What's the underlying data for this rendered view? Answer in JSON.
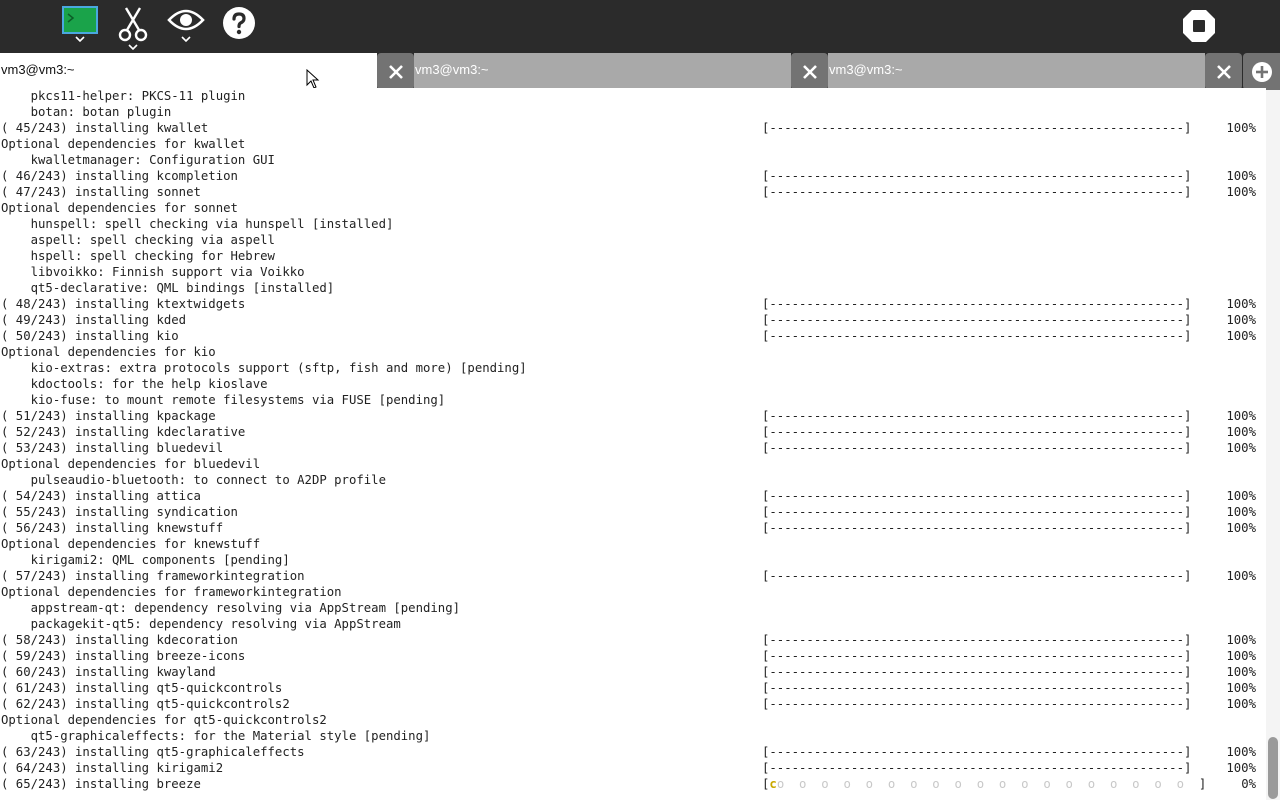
{
  "toolbar": {
    "icons": [
      "terminal-icon",
      "scissors-icon",
      "eye-icon",
      "help-icon",
      "stop-icon"
    ]
  },
  "tabs": [
    {
      "label": "vm3@vm3:~",
      "active": true
    },
    {
      "label": "vm3@vm3:~",
      "active": false
    },
    {
      "label": "vm3@vm3:~",
      "active": false
    }
  ],
  "terminal": {
    "lines": [
      {
        "text": "    pkcs11-helper: PKCS-11 plugin"
      },
      {
        "text": "    botan: botan plugin"
      },
      {
        "text": "( 45/243) installing kwallet",
        "bar": "[--------------------------------------------------------]",
        "pct": "100%"
      },
      {
        "text": "Optional dependencies for kwallet"
      },
      {
        "text": "    kwalletmanager: Configuration GUI"
      },
      {
        "text": "( 46/243) installing kcompletion",
        "bar": "[--------------------------------------------------------]",
        "pct": "100%"
      },
      {
        "text": "( 47/243) installing sonnet",
        "bar": "[--------------------------------------------------------]",
        "pct": "100%"
      },
      {
        "text": "Optional dependencies for sonnet"
      },
      {
        "text": "    hunspell: spell checking via hunspell [installed]"
      },
      {
        "text": "    aspell: spell checking via aspell"
      },
      {
        "text": "    hspell: spell checking for Hebrew"
      },
      {
        "text": "    libvoikko: Finnish support via Voikko"
      },
      {
        "text": "    qt5-declarative: QML bindings [installed]"
      },
      {
        "text": "( 48/243) installing ktextwidgets",
        "bar": "[--------------------------------------------------------]",
        "pct": "100%"
      },
      {
        "text": "( 49/243) installing kded",
        "bar": "[--------------------------------------------------------]",
        "pct": "100%"
      },
      {
        "text": "( 50/243) installing kio",
        "bar": "[--------------------------------------------------------]",
        "pct": "100%"
      },
      {
        "text": "Optional dependencies for kio"
      },
      {
        "text": "    kio-extras: extra protocols support (sftp, fish and more) [pending]"
      },
      {
        "text": "    kdoctools: for the help kioslave"
      },
      {
        "text": "    kio-fuse: to mount remote filesystems via FUSE [pending]"
      },
      {
        "text": "( 51/243) installing kpackage",
        "bar": "[--------------------------------------------------------]",
        "pct": "100%"
      },
      {
        "text": "( 52/243) installing kdeclarative",
        "bar": "[--------------------------------------------------------]",
        "pct": "100%"
      },
      {
        "text": "( 53/243) installing bluedevil",
        "bar": "[--------------------------------------------------------]",
        "pct": "100%"
      },
      {
        "text": "Optional dependencies for bluedevil"
      },
      {
        "text": "    pulseaudio-bluetooth: to connect to A2DP profile"
      },
      {
        "text": "( 54/243) installing attica",
        "bar": "[--------------------------------------------------------]",
        "pct": "100%"
      },
      {
        "text": "( 55/243) installing syndication",
        "bar": "[--------------------------------------------------------]",
        "pct": "100%"
      },
      {
        "text": "( 56/243) installing knewstuff",
        "bar": "[--------------------------------------------------------]",
        "pct": "100%"
      },
      {
        "text": "Optional dependencies for knewstuff"
      },
      {
        "text": "    kirigami2: QML components [pending]"
      },
      {
        "text": "( 57/243) installing frameworkintegration",
        "bar": "[--------------------------------------------------------]",
        "pct": "100%"
      },
      {
        "text": "Optional dependencies for frameworkintegration"
      },
      {
        "text": "    appstream-qt: dependency resolving via AppStream [pending]"
      },
      {
        "text": "    packagekit-qt5: dependency resolving via AppStream"
      },
      {
        "text": "( 58/243) installing kdecoration",
        "bar": "[--------------------------------------------------------]",
        "pct": "100%"
      },
      {
        "text": "( 59/243) installing breeze-icons",
        "bar": "[--------------------------------------------------------]",
        "pct": "100%"
      },
      {
        "text": "( 60/243) installing kwayland",
        "bar": "[--------------------------------------------------------]",
        "pct": "100%"
      },
      {
        "text": "( 61/243) installing qt5-quickcontrols",
        "bar": "[--------------------------------------------------------]",
        "pct": "100%"
      },
      {
        "text": "( 62/243) installing qt5-quickcontrols2",
        "bar": "[--------------------------------------------------------]",
        "pct": "100%"
      },
      {
        "text": "Optional dependencies for qt5-quickcontrols2"
      },
      {
        "text": "    qt5-graphicaleffects: for the Material style [pending]"
      },
      {
        "text": "( 63/243) installing qt5-graphicaleffects",
        "bar": "[--------------------------------------------------------]",
        "pct": "100%"
      },
      {
        "text": "( 64/243) installing kirigami2",
        "bar": "[--------------------------------------------------------]",
        "pct": "100%"
      },
      {
        "text": "( 65/243) installing breeze",
        "pacman": true,
        "bar_open": "[",
        "bar_pac": "c",
        "bar_dots": "o  o  o  o  o  o  o  o  o  o  o  o  o  o  o  o  o  o  o",
        "bar_close": "]",
        "pct": "0%"
      }
    ]
  }
}
